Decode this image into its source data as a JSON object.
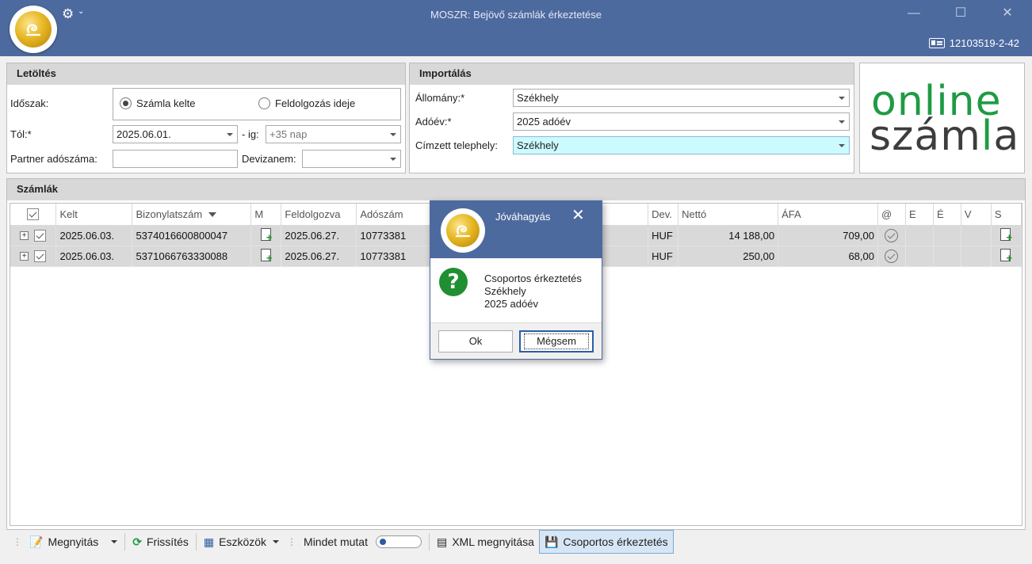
{
  "window": {
    "title": "MOSZR: Bejövő számlák érkeztetése",
    "tax_id": "12103519-2-42",
    "minimize": "—",
    "maximize": "☐",
    "close": "✕"
  },
  "download_panel": {
    "heading": "Letöltés",
    "period_label": "Időszak:",
    "radio_invoice_date": "Számla kelte",
    "radio_processing_time": "Feldolgozás ideje",
    "selected_radio": "radio_invoice_date",
    "from_label": "Tól:*",
    "from_value": "2025.06.01.",
    "to_label": "- ig:",
    "to_value": "+35 nap",
    "partner_label": "Partner adószáma:",
    "partner_value": "",
    "currency_label": "Devizanem:",
    "currency_value": ""
  },
  "import_panel": {
    "heading": "Importálás",
    "status_label": "Állomány:*",
    "status_value": "Székhely",
    "year_label": "Adóév:*",
    "year_value": "2025 adóév",
    "site_label": "Címzett telephely:",
    "site_value": "Székhely"
  },
  "brand": {
    "line1": "online",
    "line2_a": "szám",
    "line2_b": "l",
    "line2_c": "a",
    "green": "#1f9b43",
    "dark": "#3d3d3d"
  },
  "invoices": {
    "heading": "Számlák",
    "columns": [
      "Kelt",
      "Bizonylatszám",
      "M",
      "Feldolgozva",
      "Adószám",
      "Dev.",
      "Nettó",
      "ÁFA",
      "@",
      "E",
      "É",
      "V",
      "S"
    ],
    "rows": [
      {
        "kelt": "2025.06.03.",
        "bizonylat": "5374016600800047",
        "feldolgozva": "2025.06.27.",
        "adoszam": "10773381",
        "dev": "HUF",
        "netto": "14 188,00",
        "afa": "709,00"
      },
      {
        "kelt": "2025.06.03.",
        "bizonylat": "5371066763330088",
        "feldolgozva": "2025.06.27.",
        "adoszam": "10773381",
        "dev": "HUF",
        "netto": "250,00",
        "afa": "68,00"
      }
    ]
  },
  "toolbar": {
    "open": "Megnyitás",
    "refresh": "Frissítés",
    "tools": "Eszközök",
    "show_all": "Mindet mutat",
    "open_xml": "XML megnyitása",
    "group_receive": "Csoportos érkeztetés"
  },
  "dialog": {
    "title": "Jóváhagyás",
    "close": "✕",
    "icon": "?",
    "message_line1": "Csoportos érkeztetés",
    "message_line2": "Székhely",
    "message_line3": "2025 adóév",
    "ok": "Ok",
    "cancel": "Mégsem"
  },
  "colors": {
    "titlebar": "#4d6a9f",
    "accent_green": "#1f9b43",
    "selected_field": "#cbfbff"
  }
}
